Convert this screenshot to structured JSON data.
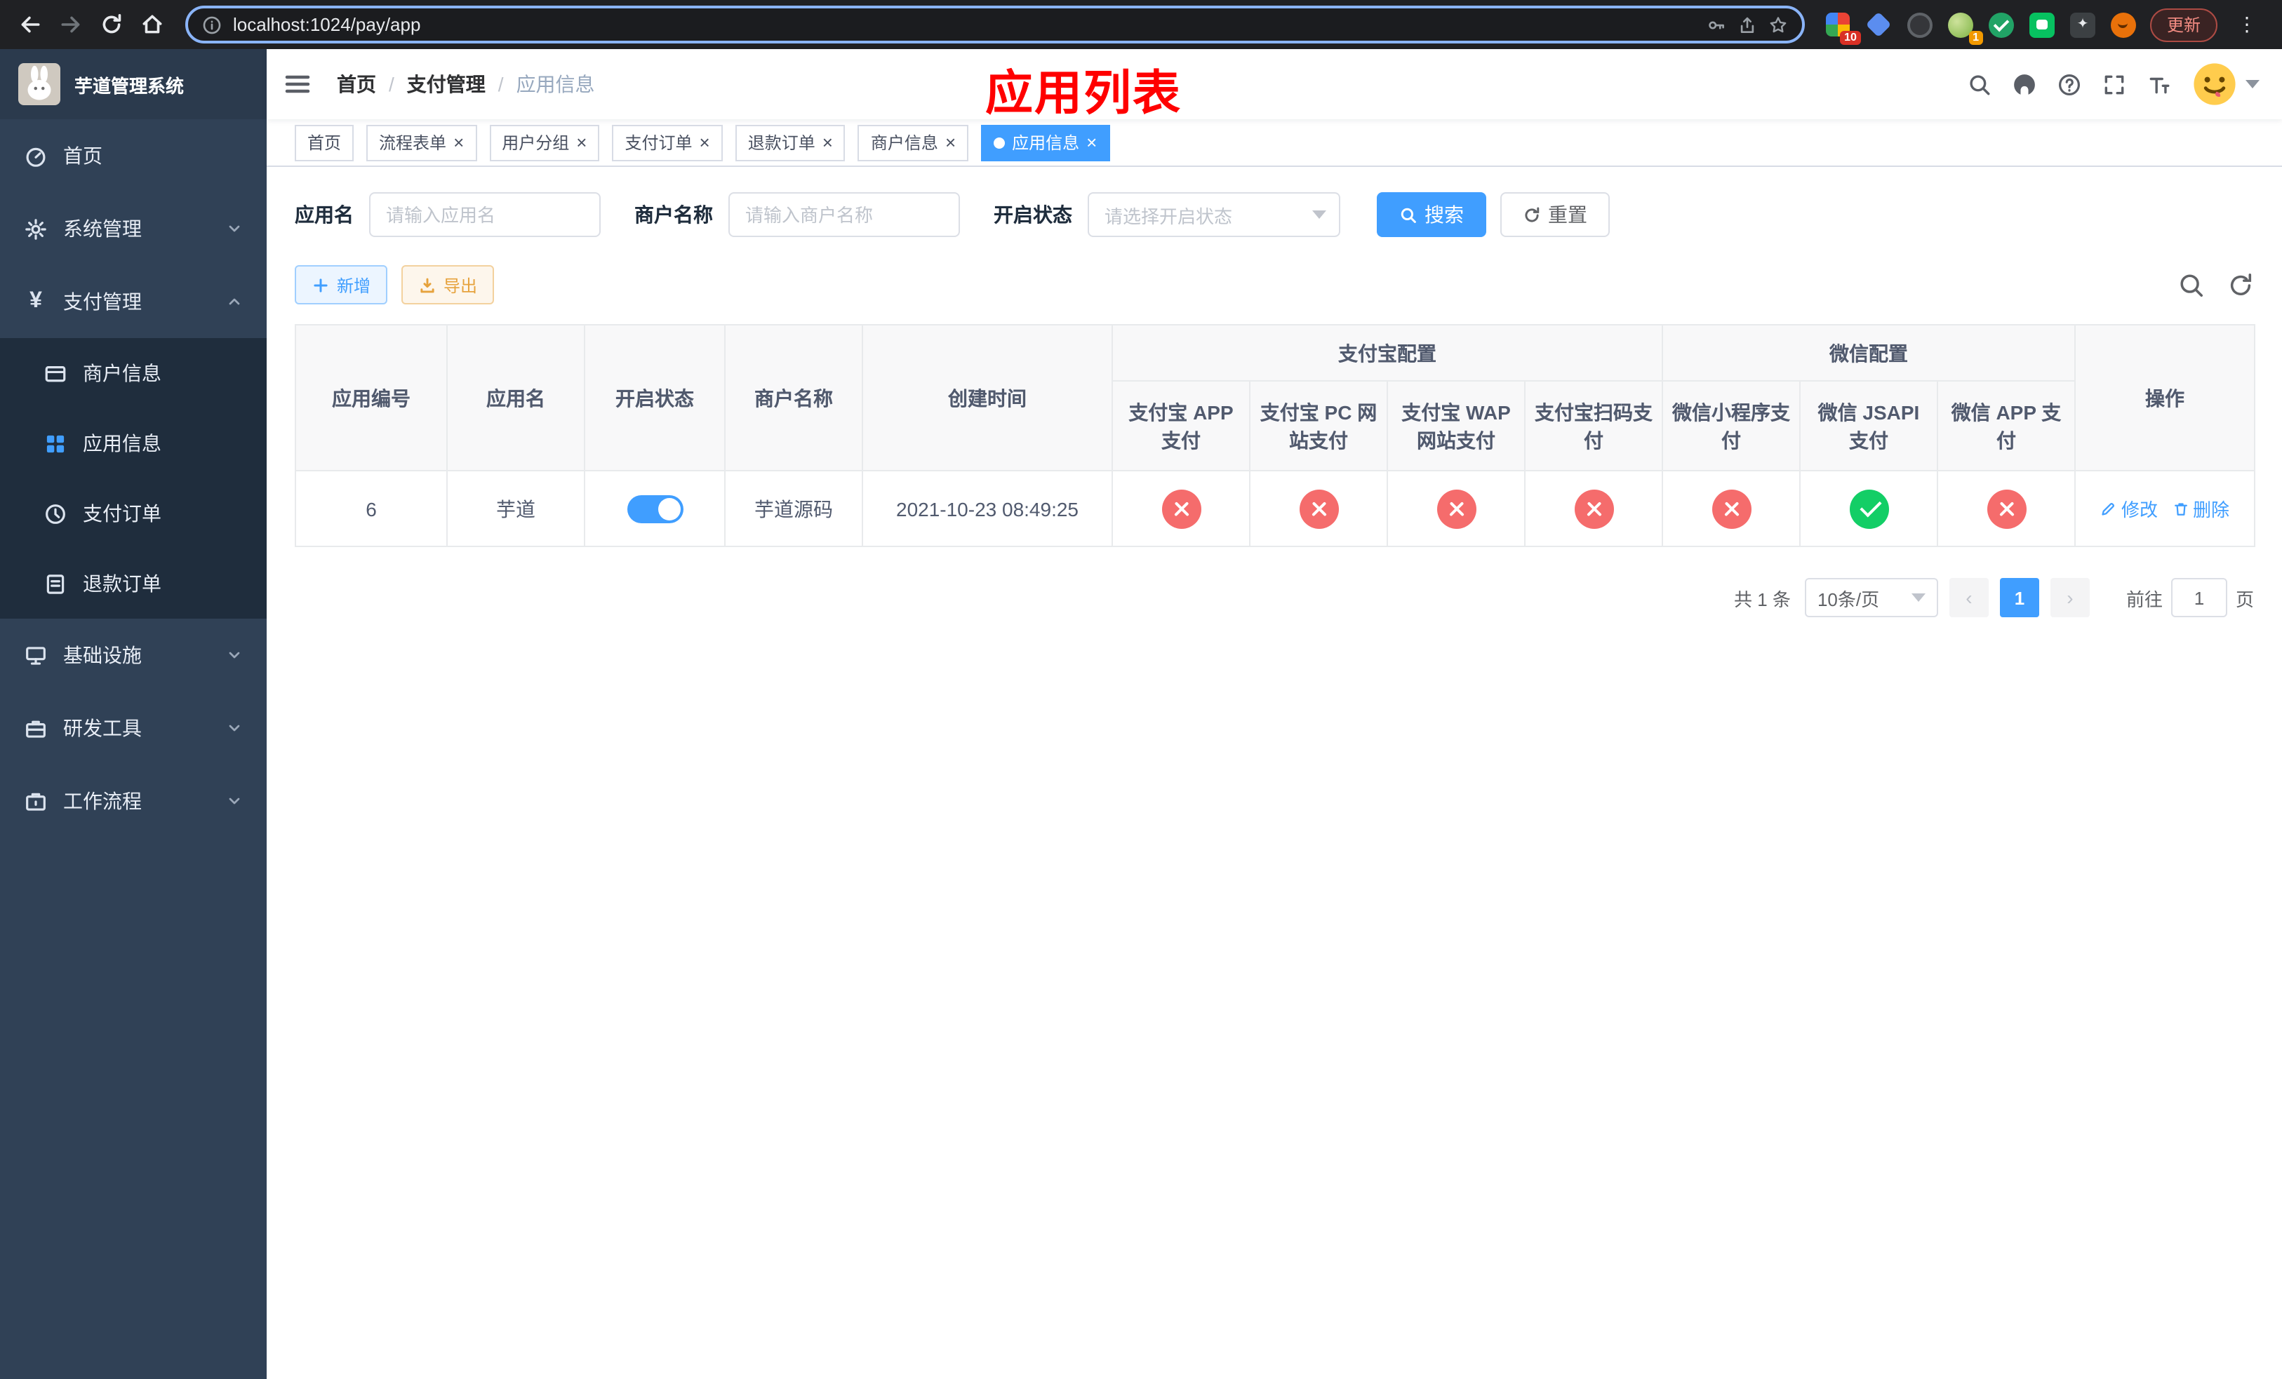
{
  "theme": {
    "accent": "#409eff",
    "success": "#13ce66",
    "danger": "#f56c6c",
    "warning": "#e6a23c",
    "sidebar_bg": "#304156",
    "submenu_bg": "#1f2d3d"
  },
  "browser": {
    "url": "localhost:1024/pay/app",
    "update_label": "更新",
    "extension_badges": {
      "first": "10",
      "avatar": "1"
    }
  },
  "sidebar": {
    "title": "芋道管理系统",
    "menu": [
      {
        "label": "首页"
      },
      {
        "label": "系统管理"
      },
      {
        "label": "支付管理"
      },
      {
        "label": "基础设施"
      },
      {
        "label": "研发工具"
      },
      {
        "label": "工作流程"
      }
    ],
    "payment_submenu": [
      {
        "label": "商户信息"
      },
      {
        "label": "应用信息"
      },
      {
        "label": "支付订单"
      },
      {
        "label": "退款订单"
      }
    ]
  },
  "navbar": {
    "breadcrumb": [
      "首页",
      "支付管理",
      "应用信息"
    ],
    "annotation": "应用列表"
  },
  "tabs": [
    {
      "label": "首页"
    },
    {
      "label": "流程表单"
    },
    {
      "label": "用户分组"
    },
    {
      "label": "支付订单"
    },
    {
      "label": "退款订单"
    },
    {
      "label": "商户信息"
    },
    {
      "label": "应用信息"
    }
  ],
  "filter": {
    "app_name_label": "应用名",
    "app_name_placeholder": "请输入应用名",
    "merchant_label": "商户名称",
    "merchant_placeholder": "请输入商户名称",
    "status_label": "开启状态",
    "status_placeholder": "请选择开启状态",
    "search_label": "搜索",
    "reset_label": "重置"
  },
  "toolbar": {
    "add_label": "新增",
    "export_label": "导出"
  },
  "table": {
    "columns": [
      "应用编号",
      "应用名",
      "开启状态",
      "商户名称",
      "创建时间"
    ],
    "groups": [
      {
        "label": "支付宝配置",
        "children": [
          "支付宝 APP 支付",
          "支付宝 PC 网站支付",
          "支付宝 WAP 网站支付",
          "支付宝扫码支付"
        ]
      },
      {
        "label": "微信配置",
        "children": [
          "微信小程序支付",
          "微信 JSAPI 支付",
          "微信 APP 支付"
        ]
      }
    ],
    "action_column": "操作",
    "rows": [
      {
        "id": "6",
        "name": "芋道",
        "enabled": true,
        "merchant": "芋道源码",
        "created_at": "2021-10-23 08:49:25",
        "pay_configs": [
          false,
          false,
          false,
          false,
          false,
          true,
          false
        ],
        "edit_label": "修改",
        "delete_label": "删除"
      }
    ]
  },
  "pagination": {
    "total_text": "共 1 条",
    "page_size_text": "10条/页",
    "current_page": "1",
    "goto_prefix": "前往",
    "goto_value": "1",
    "goto_suffix": "页"
  }
}
